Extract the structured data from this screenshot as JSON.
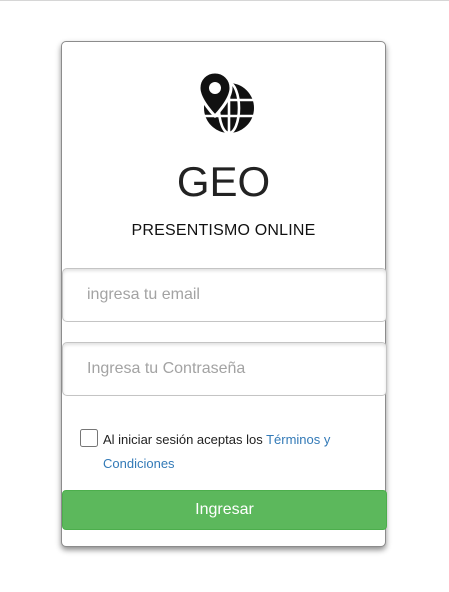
{
  "brand": {
    "logo_icon": "location-pin-globe-icon",
    "title": "GEO",
    "subtitle": "PRESENTISMO ONLINE"
  },
  "form": {
    "email_placeholder": "ingresa tu email",
    "email_value": "",
    "password_placeholder": "Ingresa tu Contraseña",
    "password_value": "",
    "terms_checked": false,
    "terms_text": "Al iniciar sesión aceptas los ",
    "terms_link": "Términos y Condiciones",
    "submit_label": "Ingresar"
  },
  "colors": {
    "submit_background": "#5cb85c",
    "link": "#337ab7"
  }
}
